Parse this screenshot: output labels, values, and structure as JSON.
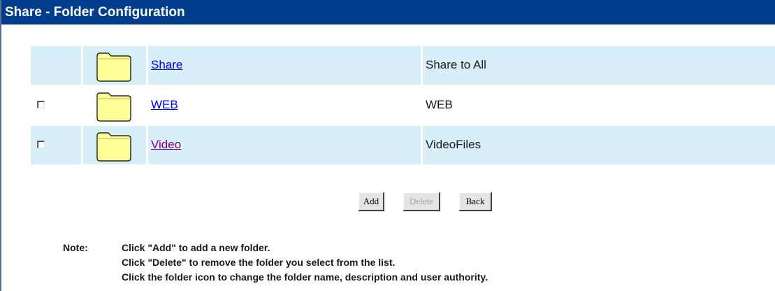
{
  "page": {
    "title": "Share - Folder Configuration"
  },
  "folders": [
    {
      "name": "Share",
      "description": "Share to All",
      "has_checkbox": false,
      "link_visited": false
    },
    {
      "name": "WEB",
      "description": "WEB",
      "has_checkbox": true,
      "link_visited": false
    },
    {
      "name": "Video",
      "description": "VideoFiles",
      "has_checkbox": true,
      "link_visited": true
    }
  ],
  "buttons": {
    "add": "Add",
    "delete": "Delete",
    "back": "Back"
  },
  "note": {
    "label": "Note:",
    "lines": [
      "Click \"Add\" to add a new folder.",
      "Click \"Delete\" to remove the folder you select from the list.",
      "Click the folder icon to change the folder name, description and user authority."
    ]
  },
  "icons": {
    "folder": "folder-icon",
    "checkbox": "checkbox"
  },
  "colors": {
    "title_bar": "#003c8c",
    "row_shade": "#d8eef8",
    "link": "#0000ee",
    "link_visited": "#800080",
    "folder_fill": "#ffff99"
  }
}
